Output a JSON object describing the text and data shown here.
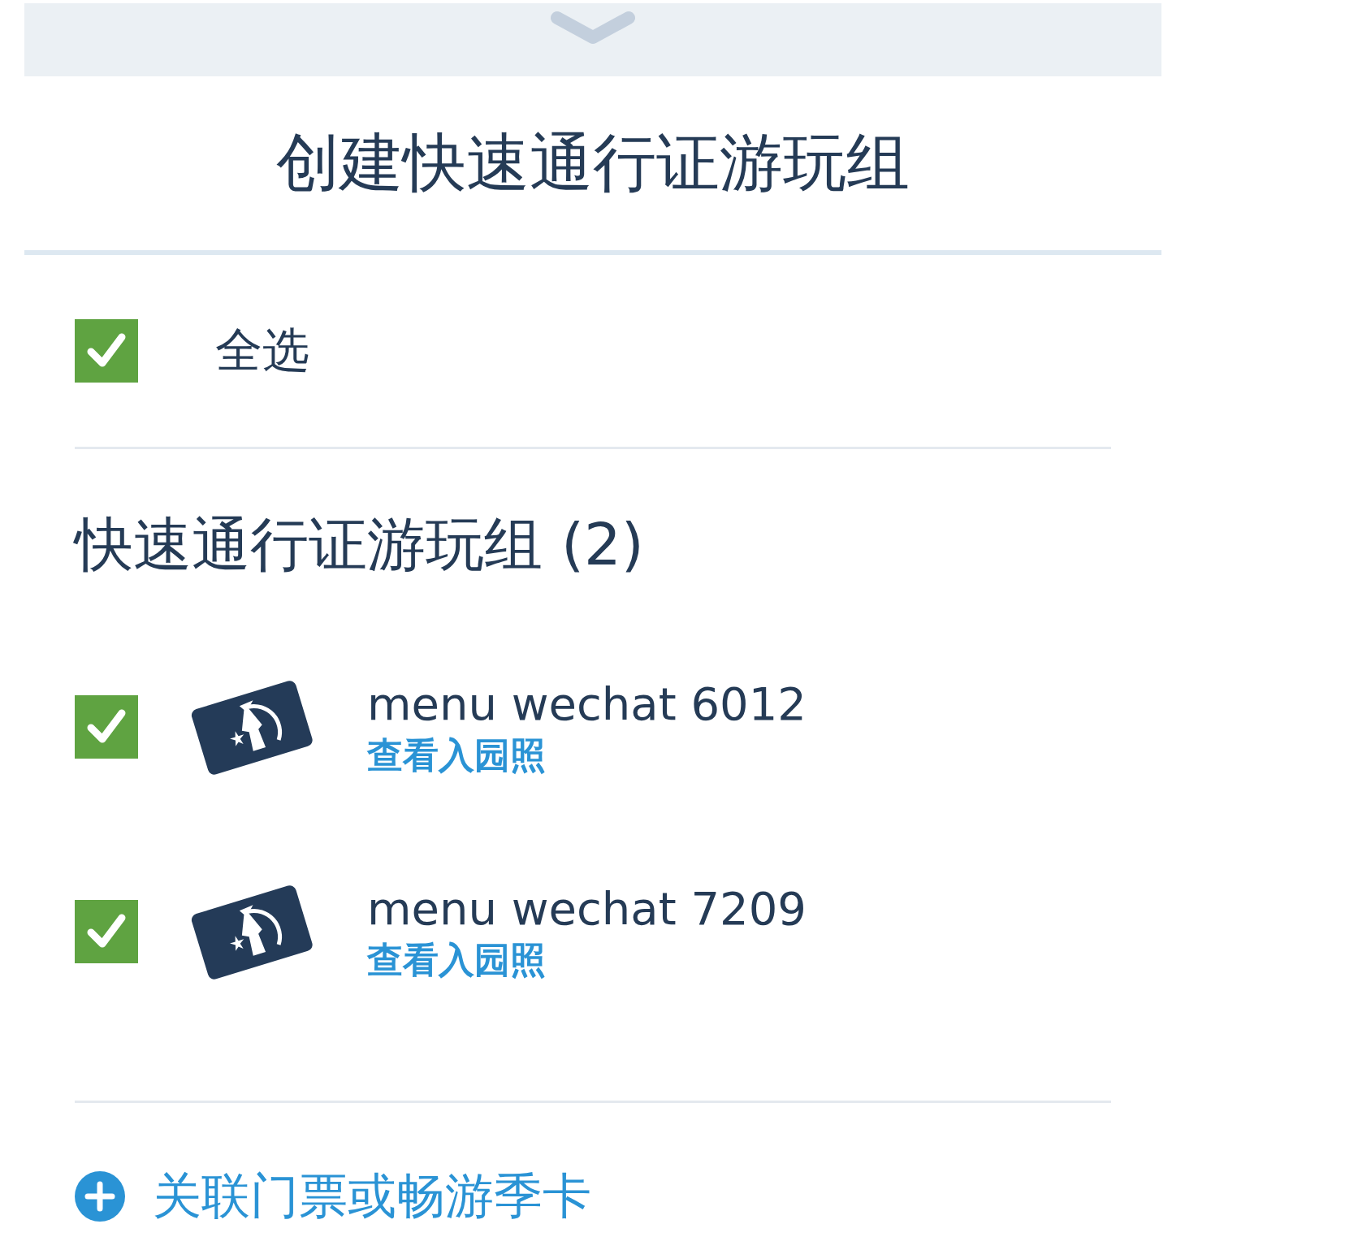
{
  "title": "创建快速通行证游玩组",
  "select_all": {
    "label": "全选",
    "checked": true
  },
  "group": {
    "heading": "快速通行证游玩组 (2)",
    "members": [
      {
        "name": "menu wechat 6012",
        "link": "查看入园照",
        "checked": true
      },
      {
        "name": "menu wechat 7209",
        "link": "查看入园照",
        "checked": true
      }
    ]
  },
  "add_link": "关联门票或畅游季卡"
}
